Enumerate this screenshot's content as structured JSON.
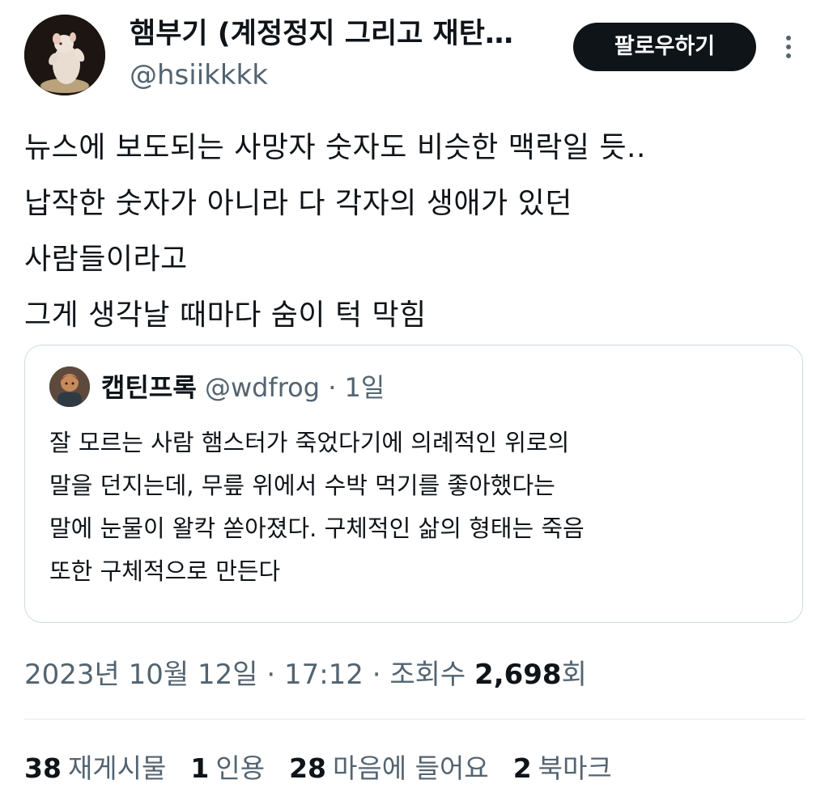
{
  "author": {
    "display_name": "햄부기 (계정정지 그리고 재탄…",
    "handle": "@hsiikkkk",
    "avatar_icon": "hamster-photo-avatar"
  },
  "follow_button": {
    "label": "팔로우하기"
  },
  "more_icon": "more-vertical-icon",
  "tweet": {
    "text": "뉴스에 보도되는 사망자 숫자도 비슷한 맥락일 듯..\n납작한 숫자가 아니라 다 각자의 생애가 있던\n사람들이라고\n그게 생각날 때마다 숨이 턱 막힘"
  },
  "quoted_tweet": {
    "display_name": "캡틴프록",
    "handle": "@wdfrog",
    "separator": "·",
    "time": "1일",
    "text": "잘 모르는 사람 햄스터가 죽었다기에 의례적인 위로의\n말을 던지는데, 무릎 위에서 수박 먹기를 좋아했다는\n말에 눈물이 왈칵 쏟아졌다. 구체적인 삶의 형태는 죽음\n또한 구체적으로 만든다",
    "avatar_icon": "quoted-user-avatar"
  },
  "meta": {
    "date": "2023년 10월 12일",
    "dot1": "·",
    "time": "17:12",
    "dot2": "·",
    "views_label_pre": "조회수",
    "views_count": "2,698",
    "views_label_post": "회"
  },
  "stats": {
    "retweets": {
      "count": "38",
      "label": "재게시물"
    },
    "quotes": {
      "count": "1",
      "label": "인용"
    },
    "likes": {
      "count": "28",
      "label": "마음에 들어요"
    },
    "bookmarks": {
      "count": "2",
      "label": "북마크"
    }
  },
  "colors": {
    "text_primary": "#0f1419",
    "text_secondary": "#536471",
    "border": "#cfd9de",
    "button_bg": "#0f1419",
    "button_text": "#ffffff"
  }
}
